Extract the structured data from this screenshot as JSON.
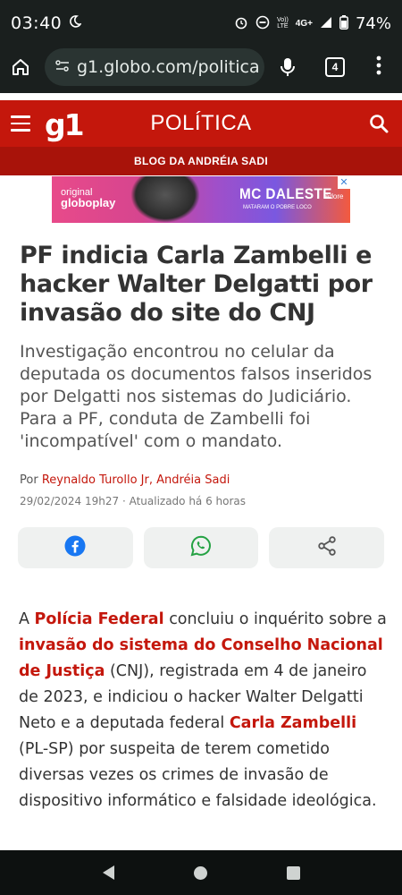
{
  "status": {
    "time": "03:40",
    "network": "4G+",
    "battery": "74%"
  },
  "browser": {
    "url": "g1.globo.com/politica",
    "tab_count": "4"
  },
  "site": {
    "logo": "g1",
    "section": "POLÍTICA",
    "blog": "BLOG DA ANDRÉIA SADI",
    "brand_color": "#c4170c"
  },
  "ad": {
    "brand_top": "original",
    "brand": "globoplay",
    "title": "MC DALESTE",
    "subtitle": "MATARAM O POBRE LOCO",
    "extra": "adore"
  },
  "article": {
    "headline": "PF indicia Carla Zambelli e hacker Walter Delgatti por invasão do site do CNJ",
    "subtitle": "Investigação encontrou no celular da deputada os documentos falsos inseridos por Delgatti nos sistemas do Judiciário. Para a PF, conduta de Zambelli foi 'incompatível' com o mandato.",
    "byline_prefix": "Por",
    "authors": "Reynaldo Turollo Jr, Andréia Sadi",
    "date": "29/02/2024 19h27 · Atualizado há 6 horas",
    "body": {
      "p1": "A ",
      "link1": "Polícia Federal",
      "p2": " concluiu o inquérito sobre a ",
      "link2": "invasão do sistema do Conselho Nacional de Justiça",
      "p3": " (CNJ), registrada em 4 de janeiro de 2023, e indiciou o hacker Walter Delgatti Neto e a deputada federal ",
      "link3": "Carla Zambelli",
      "p4": " (PL-SP) por suspeita de terem cometido diversas vezes os crimes de invasão de dispositivo informático e falsidade ideológica."
    }
  },
  "share": {
    "icons": [
      "facebook-icon",
      "whatsapp-icon",
      "share-icon"
    ],
    "facebook_color": "#1877f2",
    "whatsapp_color": "#25a244"
  }
}
